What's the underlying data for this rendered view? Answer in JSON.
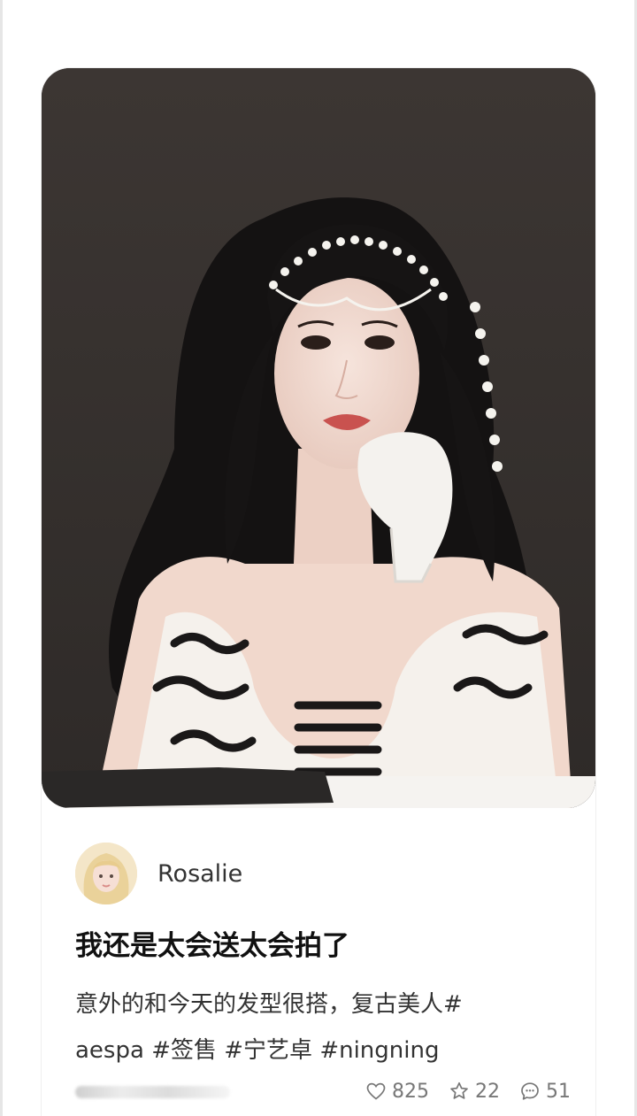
{
  "post": {
    "author": {
      "name": "Rosalie",
      "avatar_icon": "avatar-blonde-user"
    },
    "title": "我还是太会送太会拍了",
    "body_text": "意外的和今天的发型很搭，复古美人#",
    "tags": [
      "aespa",
      "#签售",
      "#宁艺卓",
      "#ningning"
    ],
    "image_icon": "portrait-photo"
  },
  "stats": {
    "likes": "825",
    "favorites": "22",
    "comments": "51"
  },
  "colors": {
    "photo_background": "#3a3532",
    "text_primary": "#111111",
    "text_secondary": "#333333",
    "stat_gray": "#777777"
  }
}
